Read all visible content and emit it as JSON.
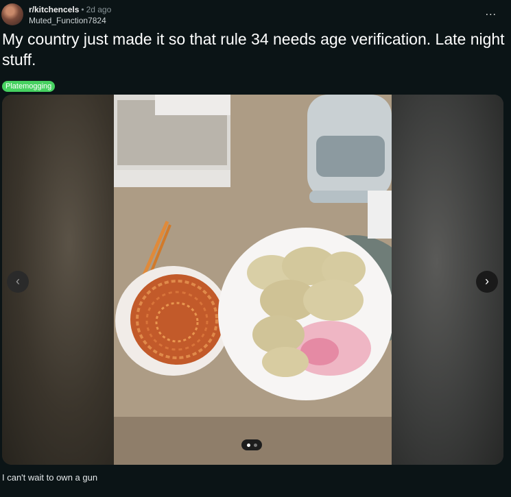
{
  "post": {
    "subreddit": "r/kitchencels",
    "separator": "•",
    "age": "2d ago",
    "author": "Muted_Function7824",
    "more_label": "...",
    "title": "My country just made it so that rule 34 needs age verification. Late night stuff.",
    "flair": "Platemogging",
    "body": "I can't wait to own a gun"
  },
  "carousel": {
    "prev_label": "‹",
    "next_label": "›",
    "current_index": 1,
    "total_images": 2
  },
  "colors": {
    "flair_bg": "#46d160",
    "page_bg": "#0b1416"
  }
}
